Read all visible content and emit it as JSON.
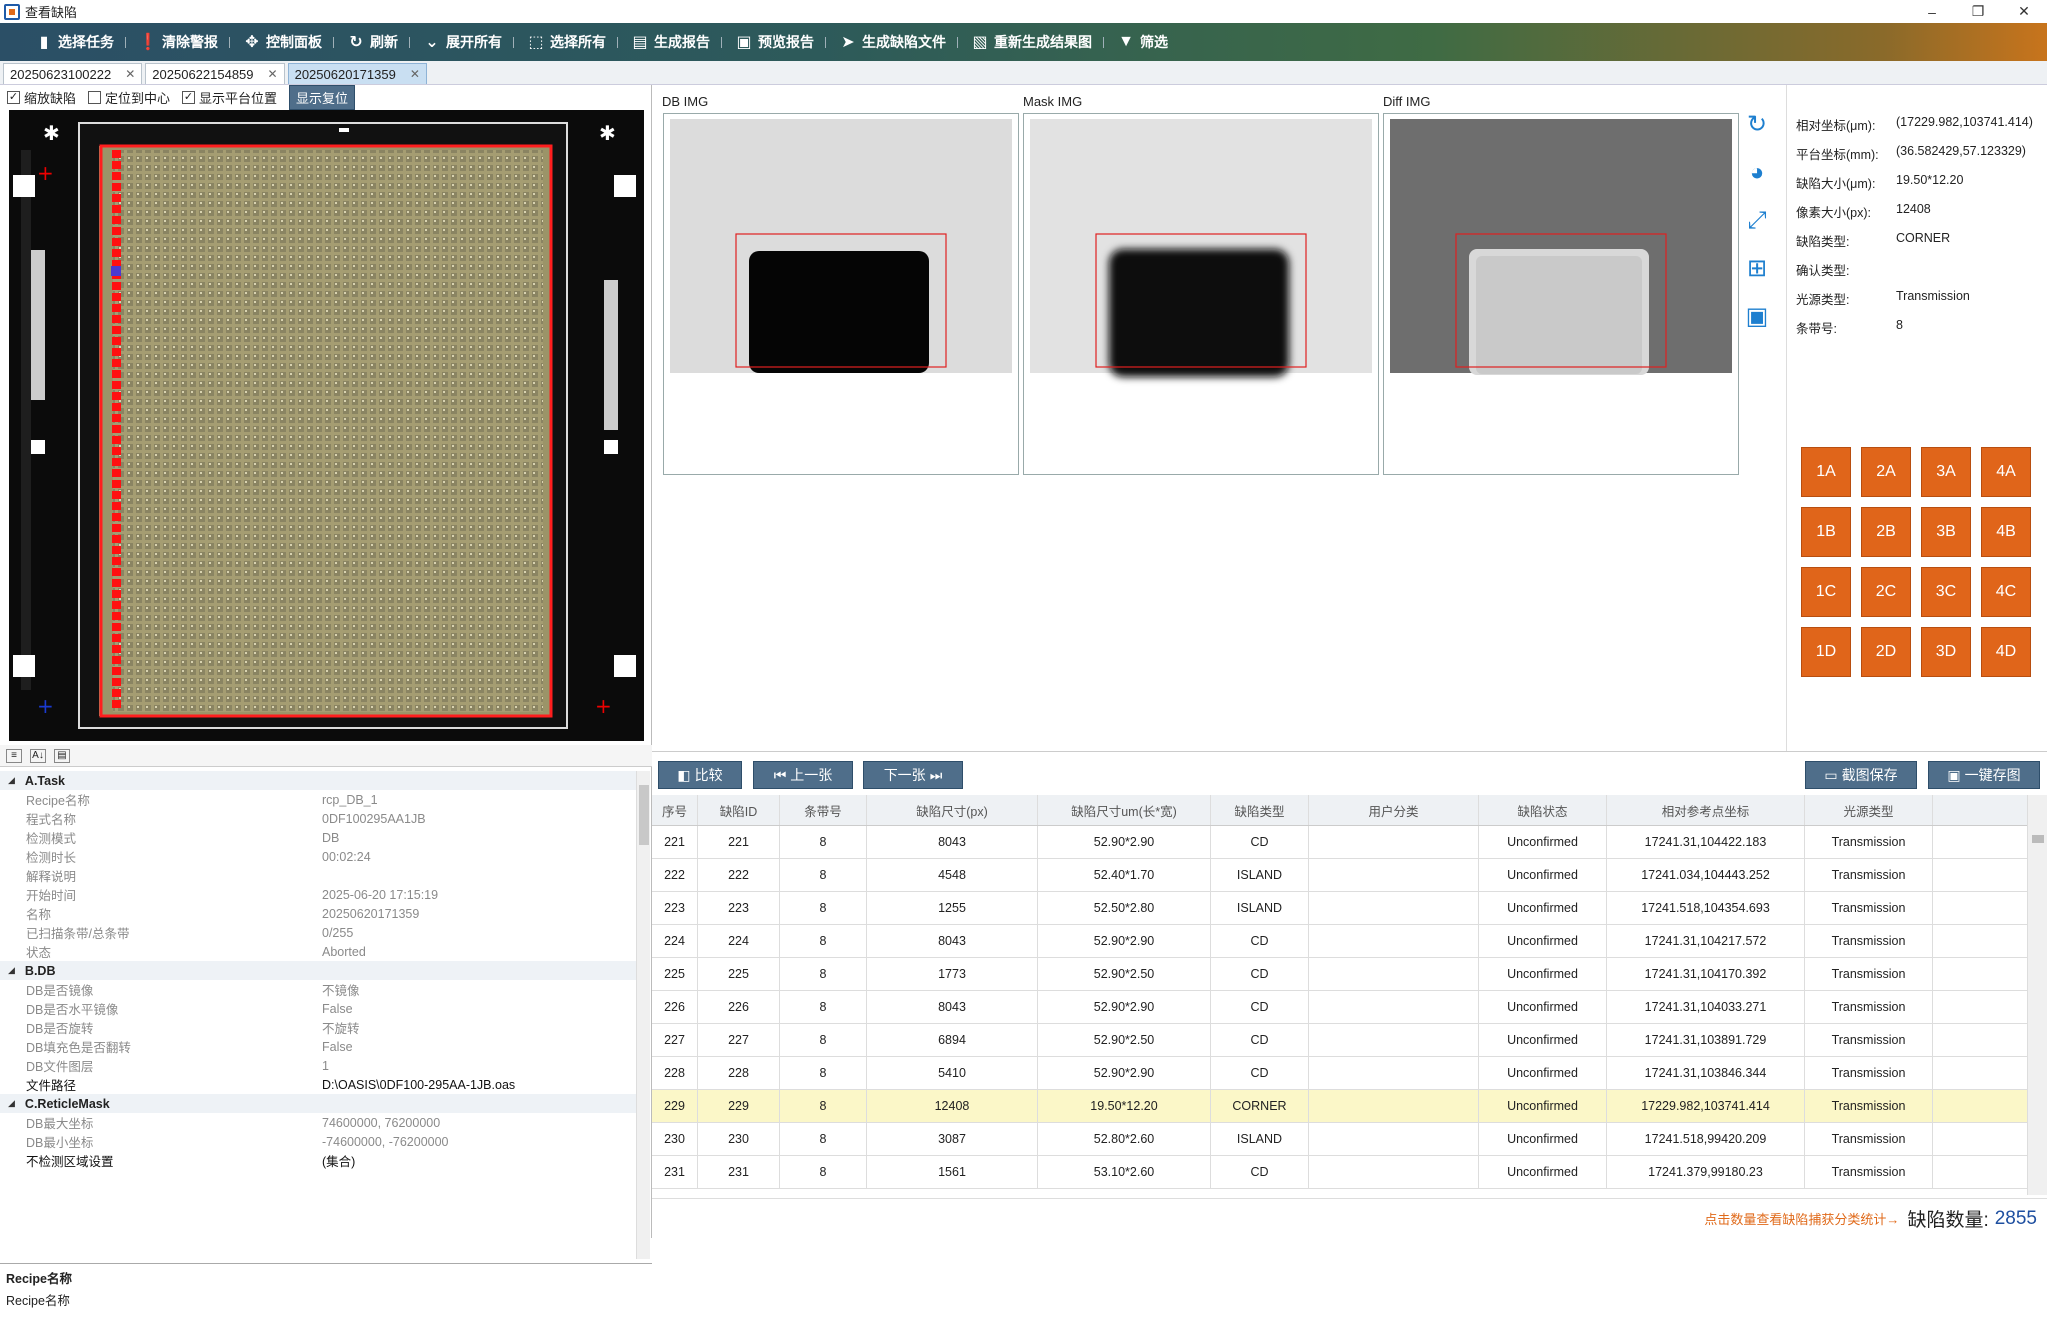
{
  "window": {
    "title": "查看缺陷",
    "min": "–",
    "restore": "❐",
    "close": "✕"
  },
  "toolbar": [
    {
      "name": "select-task",
      "label": "选择任务",
      "icon": "▮"
    },
    {
      "name": "clear-alarm",
      "label": "清除警报",
      "icon": "❗"
    },
    {
      "name": "control-panel",
      "label": "控制面板",
      "icon": "✥"
    },
    {
      "name": "refresh",
      "label": "刷新",
      "icon": "↻"
    },
    {
      "name": "expand-all",
      "label": "展开所有",
      "icon": "⌄"
    },
    {
      "name": "select-all",
      "label": "选择所有",
      "icon": "⬚"
    },
    {
      "name": "gen-report",
      "label": "生成报告",
      "icon": "▤"
    },
    {
      "name": "preview-report",
      "label": "预览报告",
      "icon": "▣"
    },
    {
      "name": "gen-defect-file",
      "label": "生成缺陷文件",
      "icon": "➤"
    },
    {
      "name": "regen-result",
      "label": "重新生成结果图",
      "icon": "▧"
    },
    {
      "name": "filter",
      "label": "筛选",
      "icon": "▼"
    }
  ],
  "tabs": [
    {
      "label": "20250623100222",
      "active": false
    },
    {
      "label": "20250622154859",
      "active": false
    },
    {
      "label": "20250620171359",
      "active": true
    }
  ],
  "checks": [
    {
      "label": "缩放缺陷",
      "on": true
    },
    {
      "label": "定位到中心",
      "on": false
    },
    {
      "label": "显示平台位置",
      "on": true
    }
  ],
  "reset_label": "显示复位",
  "props": [
    {
      "group": "A.Task",
      "rows": [
        [
          "Recipe名称",
          "rcp_DB_1"
        ],
        [
          "程式名称",
          "0DF100295AA1JB"
        ],
        [
          "检测模式",
          "DB"
        ],
        [
          "检测时长",
          "00:02:24"
        ],
        [
          "解释说明",
          ""
        ],
        [
          "开始时间",
          "2025-06-20 17:15:19"
        ],
        [
          "名称",
          "20250620171359"
        ],
        [
          "已扫描条带/总条带",
          "0/255"
        ],
        [
          "状态",
          "Aborted"
        ]
      ]
    },
    {
      "group": "B.DB",
      "rows": [
        [
          "DB是否镜像",
          "不镜像"
        ],
        [
          "DB是否水平镜像",
          "False"
        ],
        [
          "DB是否旋转",
          "不旋转"
        ],
        [
          "DB填充色是否翻转",
          "False"
        ],
        [
          "DB文件图层",
          "1"
        ],
        [
          "文件路径",
          "D:\\OASIS\\0DF100-295AA-1JB.oas"
        ]
      ]
    },
    {
      "group": "C.ReticleMask",
      "rows": [
        [
          "DB最大坐标",
          "74600000, 76200000"
        ],
        [
          "DB最小坐标",
          "-74600000, -76200000"
        ],
        [
          "不检测区域设置",
          "(集合)"
        ]
      ]
    }
  ],
  "desc": {
    "title": "Recipe名称",
    "text": "Recipe名称"
  },
  "images": [
    {
      "label": "DB IMG"
    },
    {
      "label": "Mask IMG"
    },
    {
      "label": "Diff IMG"
    }
  ],
  "info": [
    [
      "相对坐标(μm):",
      "(17229.982,103741.414)"
    ],
    [
      "平台坐标(mm):",
      "(36.582429,57.123329)"
    ],
    [
      "缺陷大小(μm):",
      "19.50*12.20"
    ],
    [
      "像素大小(px):",
      "12408"
    ],
    [
      "缺陷类型:",
      "CORNER"
    ],
    [
      "确认类型:",
      ""
    ],
    [
      "光源类型:",
      "Transmission"
    ],
    [
      "条带号:",
      "8"
    ]
  ],
  "grid": [
    "1A",
    "2A",
    "3A",
    "4A",
    "1B",
    "2B",
    "3B",
    "4B",
    "1C",
    "2C",
    "3C",
    "4C",
    "1D",
    "2D",
    "3D",
    "4D"
  ],
  "nav": {
    "compare": "比较",
    "prev": "上一张",
    "next": "下一张",
    "snap": "截图保存",
    "save_all": "一键存图"
  },
  "table": {
    "headers": [
      "序号",
      "缺陷ID",
      "条带号",
      "缺陷尺寸(px)",
      "缺陷尺寸um(长*宽)",
      "缺陷类型",
      "用户分类",
      "缺陷状态",
      "相对参考点坐标",
      "光源类型"
    ],
    "rows": [
      [
        "221",
        "221",
        "8",
        "8043",
        "52.90*2.90",
        "CD",
        "",
        "Unconfirmed",
        "17241.31,104422.183",
        "Transmission"
      ],
      [
        "222",
        "222",
        "8",
        "4548",
        "52.40*1.70",
        "ISLAND",
        "",
        "Unconfirmed",
        "17241.034,104443.252",
        "Transmission"
      ],
      [
        "223",
        "223",
        "8",
        "1255",
        "52.50*2.80",
        "ISLAND",
        "",
        "Unconfirmed",
        "17241.518,104354.693",
        "Transmission"
      ],
      [
        "224",
        "224",
        "8",
        "8043",
        "52.90*2.90",
        "CD",
        "",
        "Unconfirmed",
        "17241.31,104217.572",
        "Transmission"
      ],
      [
        "225",
        "225",
        "8",
        "1773",
        "52.90*2.50",
        "CD",
        "",
        "Unconfirmed",
        "17241.31,104170.392",
        "Transmission"
      ],
      [
        "226",
        "226",
        "8",
        "8043",
        "52.90*2.90",
        "CD",
        "",
        "Unconfirmed",
        "17241.31,104033.271",
        "Transmission"
      ],
      [
        "227",
        "227",
        "8",
        "6894",
        "52.90*2.50",
        "CD",
        "",
        "Unconfirmed",
        "17241.31,103891.729",
        "Transmission"
      ],
      [
        "228",
        "228",
        "8",
        "5410",
        "52.90*2.90",
        "CD",
        "",
        "Unconfirmed",
        "17241.31,103846.344",
        "Transmission"
      ],
      [
        "229",
        "229",
        "8",
        "12408",
        "19.50*12.20",
        "CORNER",
        "",
        "Unconfirmed",
        "17229.982,103741.414",
        "Transmission"
      ],
      [
        "230",
        "230",
        "8",
        "3087",
        "52.80*2.60",
        "ISLAND",
        "",
        "Unconfirmed",
        "17241.518,99420.209",
        "Transmission"
      ],
      [
        "231",
        "231",
        "8",
        "1561",
        "53.10*2.60",
        "CD",
        "",
        "Unconfirmed",
        "17241.379,99180.23",
        "Transmission"
      ]
    ],
    "selected_index": 8
  },
  "status": {
    "link": "点击数量查看缺陷捕获分类统计→",
    "label": "缺陷数量:",
    "count": "2855"
  }
}
